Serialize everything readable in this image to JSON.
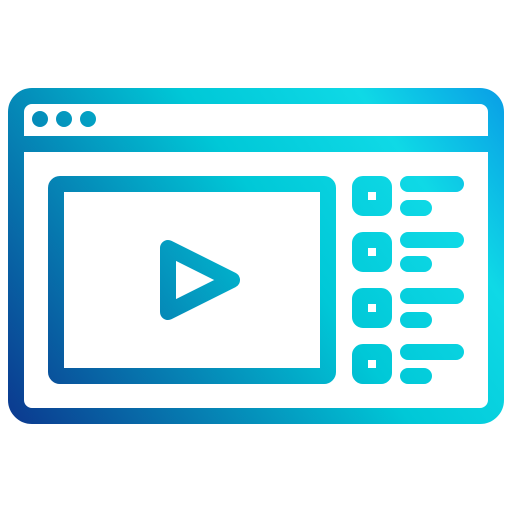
{
  "icon": {
    "name": "video-player-window-icon",
    "style": "outline",
    "gradient": {
      "start": "#0B3D91",
      "middle": "#00C8D7",
      "end": "#0FD9E6",
      "accent_top_right": "#0AA0E6"
    },
    "background": "#ffffff",
    "window": {
      "control_dots": 3
    },
    "player": {
      "play_icon": "play-icon"
    },
    "playlist": {
      "item_count": 4
    }
  }
}
